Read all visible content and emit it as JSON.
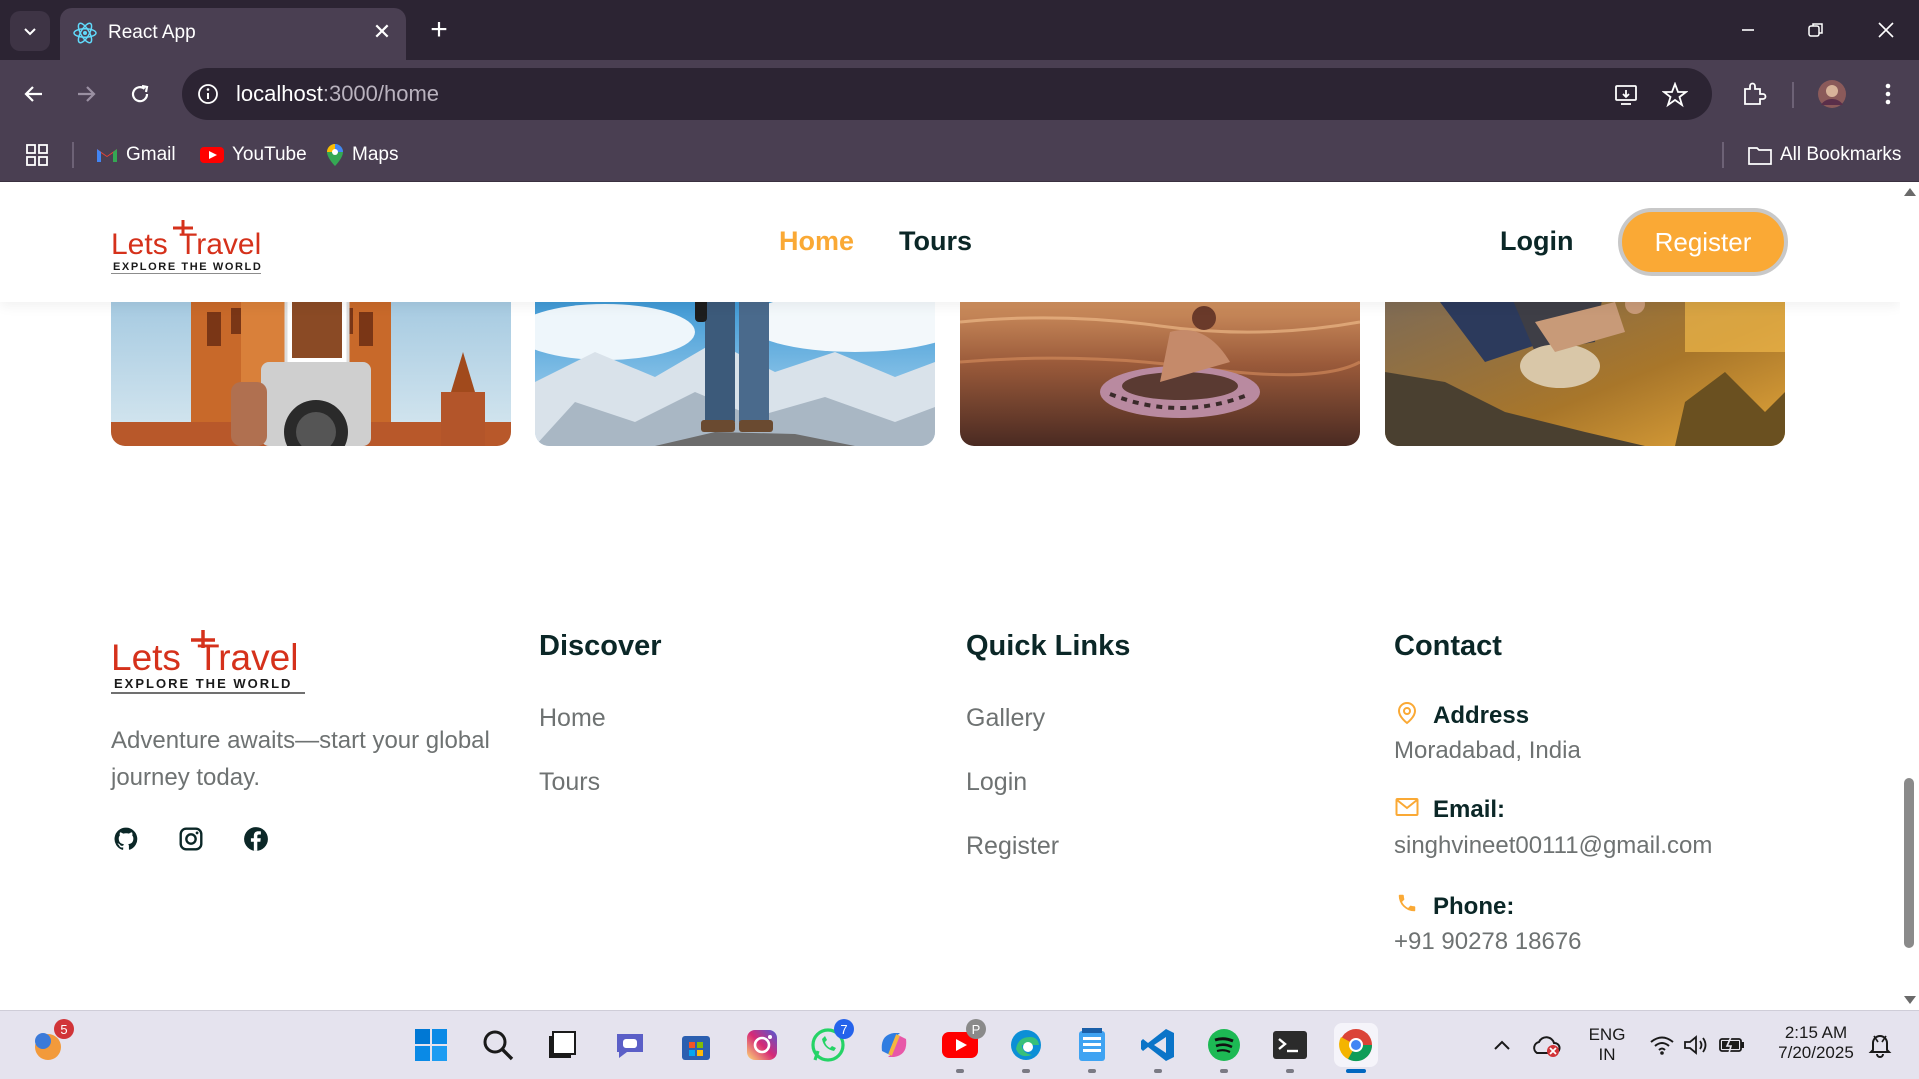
{
  "browser": {
    "tab_title": "React App",
    "url_host": "localhost",
    "url_path": ":3000/home",
    "bookmarks": [
      {
        "label": "Gmail",
        "icon": "gmail-icon"
      },
      {
        "label": "YouTube",
        "icon": "youtube-icon"
      },
      {
        "label": "Maps",
        "icon": "maps-icon"
      }
    ],
    "all_bookmarks": "All Bookmarks"
  },
  "header": {
    "logo_text": "Lets Travel",
    "logo_tagline": "EXPLORE THE WORLD",
    "nav": [
      {
        "label": "Home",
        "active": true
      },
      {
        "label": "Tours",
        "active": false
      }
    ],
    "login": "Login",
    "register": "Register"
  },
  "colors": {
    "accent": "#faa935",
    "heading": "#0b2727",
    "text": "#6e7272",
    "logo_red": "#d5311b"
  },
  "footer": {
    "description": "Adventure awaits—start your global journey today.",
    "socials": [
      "github-icon",
      "instagram-icon",
      "facebook-icon"
    ],
    "discover": {
      "title": "Discover",
      "links": [
        "Home",
        "Tours"
      ]
    },
    "quick_links": {
      "title": "Quick Links",
      "links": [
        "Gallery",
        "Login",
        "Register"
      ]
    },
    "contact": {
      "title": "Contact",
      "address_label": "Address",
      "address_value": "Moradabad, India",
      "email_label": "Email:",
      "email_value": "singhvineet00111@gmail.com",
      "phone_label": "Phone:",
      "phone_value": "+91 90278 18676"
    }
  },
  "taskbar": {
    "weather_badge": "5",
    "whatsapp_badge": "7",
    "youtube_badge": "P",
    "language": "ENG",
    "region": "IN",
    "time": "2:15 AM",
    "date": "7/20/2025"
  }
}
